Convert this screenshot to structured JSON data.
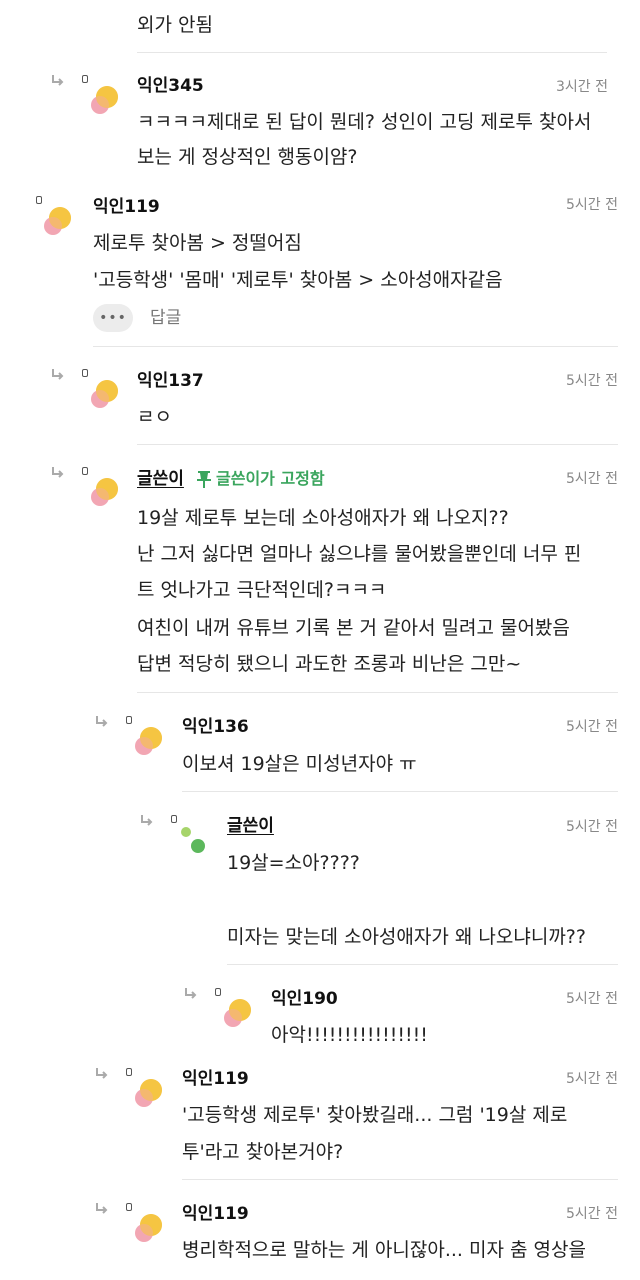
{
  "comments": [
    {
      "id": "c0",
      "text_lines": [
        "외가 안됨"
      ]
    },
    {
      "id": "c1",
      "nick": "익인345",
      "time": "3시간 전",
      "text_lines": [
        "ㅋㅋㅋㅋ제대로 된 답이 뭔데? 성인이 고딩 제로투 찾아서",
        "보는 게 정상적인 행동이얌?"
      ]
    },
    {
      "id": "c2",
      "nick": "익인119",
      "time": "5시간 전",
      "text_lines": [
        "제로투 찾아봄 > 정떨어짐",
        "'고등학생' '몸매' '제로투' 찾아봄 > 소아성애자같음"
      ],
      "more": "•••",
      "reply_label": "답글"
    },
    {
      "id": "c3",
      "nick": "익인137",
      "time": "5시간 전",
      "text_lines": [
        "ㄹㅇ"
      ]
    },
    {
      "id": "c4",
      "nick": "글쓴이",
      "pin_label": "글쓴이가 고정함",
      "time": "5시간 전",
      "text_lines": [
        "19살 제로투 보는데 소아성애자가 왜 나오지??",
        "난 그저 싫다면 얼마나 싫으냐를 물어봤을뿐인데 너무 핀",
        "트 엇나가고 극단적인데?ㅋㅋㅋ",
        "여친이 내꺼 유튜브 기록 본 거 같아서 밀려고 물어봤음",
        "답변 적당히 됐으니 과도한 조롱과 비난은 그만~"
      ]
    },
    {
      "id": "c5",
      "nick": "익인136",
      "time": "5시간 전",
      "text_lines": [
        "이보셔 19살은 미성년자야 ㅠ"
      ]
    },
    {
      "id": "c6",
      "nick": "글쓴이",
      "time": "5시간 전",
      "text_lines": [
        "19살=소아????",
        "",
        "미자는 맞는데 소아성애자가 왜 나오냐니까??"
      ]
    },
    {
      "id": "c7",
      "nick": "익인190",
      "time": "5시간 전",
      "text_lines": [
        "아악!!!!!!!!!!!!!!!!"
      ]
    },
    {
      "id": "c8",
      "nick": "익인119",
      "time": "5시간 전",
      "text_lines": [
        "'고등학생 제로투' 찾아봤길래... 그럼 '19살 제로",
        "투'라고 찾아본거야?"
      ]
    },
    {
      "id": "c9",
      "nick": "익인119",
      "time": "5시간 전",
      "text_lines": [
        "병리학적으로 말하는 게 아니잖아... 미자 춤 영상을"
      ]
    }
  ],
  "colors": {
    "pin_green": "#3aa55d",
    "avatar_yellow": "#f5c542",
    "avatar_pink": "#f2a6b3",
    "op_green": "#5cb85c",
    "op_lightgreen": "#a6d46a"
  }
}
